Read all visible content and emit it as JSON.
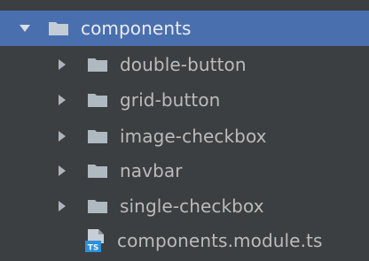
{
  "tree": {
    "root": {
      "label": "components",
      "expanded": true,
      "selected": true,
      "icon": "folder-icon"
    },
    "children": [
      {
        "label": "double-button",
        "type": "folder",
        "expanded": false
      },
      {
        "label": "grid-button",
        "type": "folder",
        "expanded": false
      },
      {
        "label": "image-checkbox",
        "type": "folder",
        "expanded": false
      },
      {
        "label": "navbar",
        "type": "folder",
        "expanded": false
      },
      {
        "label": "single-checkbox",
        "type": "folder",
        "expanded": false
      }
    ],
    "file": {
      "label": "components.module.ts",
      "type": "file",
      "icon_text": "TS"
    }
  },
  "colors": {
    "background": "#3c3f41",
    "selection": "#4a6fae",
    "text": "#bbbbbb",
    "folder": "#aeb9c0",
    "ts_badge": "#2f8fd6"
  }
}
